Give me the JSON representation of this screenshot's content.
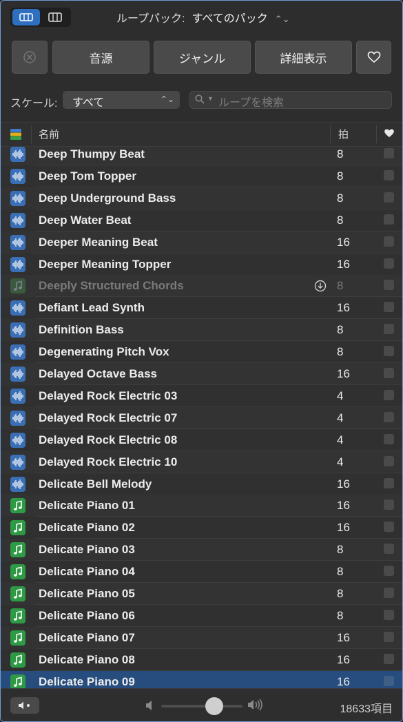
{
  "top": {
    "loop_pack_label": "ループパック:",
    "loop_pack_value": "すべてのパック"
  },
  "filters": {
    "genre_source": "音源",
    "genre": "ジャンル",
    "details": "詳細表示"
  },
  "search": {
    "scale_label": "スケール:",
    "scale_value": "すべて",
    "placeholder": "ループを検索"
  },
  "columns": {
    "name": "名前",
    "beats": "拍"
  },
  "rows": [
    {
      "name": "Deep Thumpy Beat",
      "beats": "8",
      "type": "audio"
    },
    {
      "name": "Deep Tom Topper",
      "beats": "8",
      "type": "audio"
    },
    {
      "name": "Deep Underground Bass",
      "beats": "8",
      "type": "audio"
    },
    {
      "name": "Deep Water Beat",
      "beats": "8",
      "type": "audio"
    },
    {
      "name": "Deeper Meaning Beat",
      "beats": "16",
      "type": "audio"
    },
    {
      "name": "Deeper Meaning Topper",
      "beats": "16",
      "type": "audio"
    },
    {
      "name": "Deeply Structured Chords",
      "beats": "8",
      "type": "midi-dim"
    },
    {
      "name": "Defiant Lead Synth",
      "beats": "16",
      "type": "audio"
    },
    {
      "name": "Definition Bass",
      "beats": "8",
      "type": "audio"
    },
    {
      "name": "Degenerating Pitch Vox",
      "beats": "8",
      "type": "audio"
    },
    {
      "name": "Delayed Octave Bass",
      "beats": "16",
      "type": "audio"
    },
    {
      "name": "Delayed Rock Electric 03",
      "beats": "4",
      "type": "audio"
    },
    {
      "name": "Delayed Rock Electric 07",
      "beats": "4",
      "type": "audio"
    },
    {
      "name": "Delayed Rock Electric 08",
      "beats": "4",
      "type": "audio"
    },
    {
      "name": "Delayed Rock Electric 10",
      "beats": "4",
      "type": "audio"
    },
    {
      "name": "Delicate Bell Melody",
      "beats": "16",
      "type": "audio"
    },
    {
      "name": "Delicate Piano 01",
      "beats": "16",
      "type": "midi"
    },
    {
      "name": "Delicate Piano 02",
      "beats": "16",
      "type": "midi"
    },
    {
      "name": "Delicate Piano 03",
      "beats": "8",
      "type": "midi"
    },
    {
      "name": "Delicate Piano 04",
      "beats": "8",
      "type": "midi"
    },
    {
      "name": "Delicate Piano 05",
      "beats": "8",
      "type": "midi"
    },
    {
      "name": "Delicate Piano 06",
      "beats": "8",
      "type": "midi"
    },
    {
      "name": "Delicate Piano 07",
      "beats": "16",
      "type": "midi"
    },
    {
      "name": "Delicate Piano 08",
      "beats": "16",
      "type": "midi"
    },
    {
      "name": "Delicate Piano 09",
      "beats": "16",
      "type": "midi",
      "selected": true
    }
  ],
  "footer": {
    "item_count": "18633項目"
  }
}
